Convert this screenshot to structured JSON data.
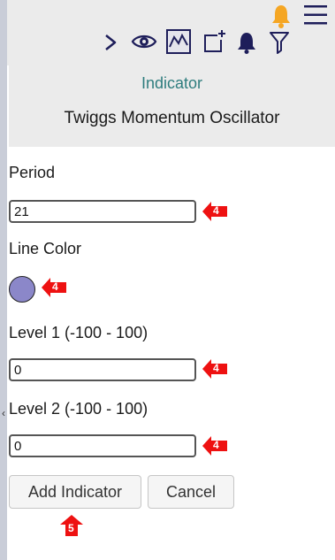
{
  "toolbar": {
    "icons": [
      "bell-icon",
      "menu-icon",
      "play-icon",
      "eye-icon",
      "indicator-icon",
      "add-panel-icon",
      "bell-icon",
      "filter-icon"
    ]
  },
  "panel": {
    "section_label": "Indicator",
    "indicator_name": "Twiggs Momentum Oscillator"
  },
  "form": {
    "period": {
      "label": "Period",
      "value": "21"
    },
    "line_color": {
      "label": "Line Color",
      "color": "#8b87c9"
    },
    "level1": {
      "label": "Level 1 (-100 - 100)",
      "value": "0"
    },
    "level2": {
      "label": "Level 2 (-100 - 100)",
      "value": "0"
    }
  },
  "buttons": {
    "add_label": "Add Indicator",
    "cancel_label": "Cancel"
  },
  "hints": {
    "period": "4",
    "line_color": "4",
    "level1": "4",
    "level2": "4",
    "add": "5"
  },
  "colors": {
    "accent_text": "#2e7d7e",
    "hint_red": "#ee1111",
    "icon_navy": "#1e1e5a",
    "bell_orange": "#f5a623"
  }
}
